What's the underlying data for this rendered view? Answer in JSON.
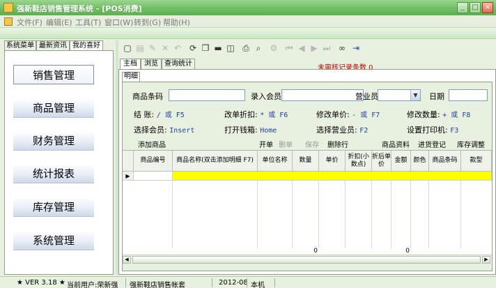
{
  "window": {
    "title": "强新鞋店销售管理系统 - [POS消费]",
    "min_label": "_",
    "max_label": "□",
    "close_label": "×"
  },
  "menu": [
    {
      "label": "文件(F)"
    },
    {
      "label": "编辑(E)"
    },
    {
      "label": "工具(T)"
    },
    {
      "label": "窗口(W)"
    },
    {
      "label": "转到(G)"
    },
    {
      "label": "帮助(H)"
    }
  ],
  "left_tabs": [
    {
      "label": "系统菜单"
    },
    {
      "label": "最新资讯"
    },
    {
      "label": "我的喜好"
    }
  ],
  "nav": [
    {
      "label": "销售管理"
    },
    {
      "label": "商品管理"
    },
    {
      "label": "财务管理"
    },
    {
      "label": "统计报表"
    },
    {
      "label": "库存管理"
    },
    {
      "label": "系统管理"
    }
  ],
  "toolbar_icons": [
    "new-icon",
    "open-icon",
    "edit-icon",
    "delete-icon",
    "undo-icon",
    "refresh-icon",
    "copy-icon",
    "save-icon",
    "preview-icon",
    "print-icon",
    "search-icon",
    "settings-icon",
    "first-icon",
    "prev-icon",
    "next-icon",
    "last-icon",
    "binoculars-icon",
    "exit-icon"
  ],
  "main_tabs": [
    {
      "label": "主档"
    },
    {
      "label": "浏览"
    },
    {
      "label": "查询统计"
    }
  ],
  "unaudit_text": "未审核记录条数 0",
  "sub_tab": "明细",
  "form": {
    "barcode_label": "商品条码",
    "member_label": "录入会员",
    "clerk_label": "营业员",
    "date_label": "日期",
    "barcode_value": "",
    "member_value": "",
    "clerk_value": "",
    "date_value": ""
  },
  "hotkeys": [
    {
      "label": "结    账:",
      "key": "/ 或 F5"
    },
    {
      "label": "改单折扣:",
      "key": "* 或 F6"
    },
    {
      "label": "修改单价:",
      "key": "- 或 F7"
    },
    {
      "label": "修改数量:",
      "key": "+ 或 F8"
    },
    {
      "label": "选择会员:",
      "key": "Insert"
    },
    {
      "label": "打开钱箱:",
      "key": "Home"
    },
    {
      "label": "选择营业员:",
      "key": "F2"
    },
    {
      "label": "设置打印机:",
      "key": "F3"
    }
  ],
  "actions": {
    "add": "添加商品",
    "open": "开单",
    "delete": "删单",
    "save": "保存",
    "delete_row": "删除行",
    "goods_info": "商品资料",
    "purchase": "进货登记",
    "stock_adjust": "库存调整"
  },
  "grid": {
    "columns": [
      "商品编号",
      "商品名称(双击添加明细 F7)",
      "单位名称",
      "数量",
      "单价",
      "折扣(小数点)",
      "折后单价",
      "金额",
      "颜色",
      "商品条码",
      "款型"
    ],
    "qty_total": "0",
    "amount_total": "0"
  },
  "status": {
    "version": "★ VER 3.18 ★",
    "user": "当前用户:荣新强",
    "account": "强新鞋店销售帐套",
    "period": "2012-08",
    "location": "本机"
  },
  "colors": {
    "title_green": "#6fbf62",
    "selected_row": "#ffff00",
    "alert_red": "#c00000",
    "hotkey_blue": "#1f3f9f"
  }
}
